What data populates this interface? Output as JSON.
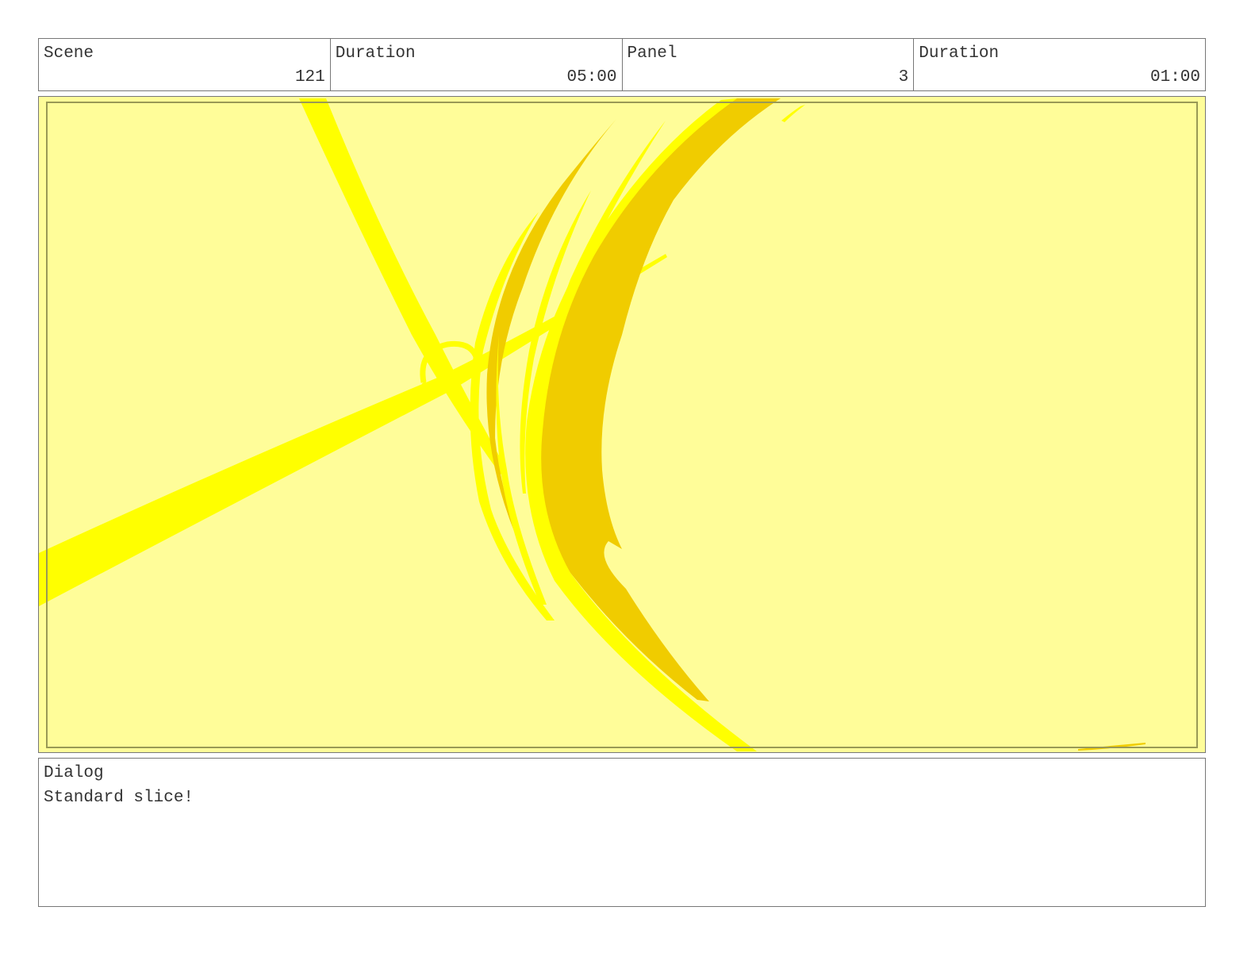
{
  "header": {
    "scene_label": "Scene",
    "scene_value": "121",
    "scene_duration_label": "Duration",
    "scene_duration_value": "05:00",
    "panel_label": "Panel",
    "panel_value": "3",
    "panel_duration_label": "Duration",
    "panel_duration_value": "01:00"
  },
  "artwork": {
    "background_color": "#fffd99",
    "stroke_bright_color": "#ffff00",
    "stroke_dark_color": "#f0cc00",
    "safe_frame_color": "#999955"
  },
  "dialog": {
    "label": "Dialog",
    "text": "Standard slice!"
  }
}
